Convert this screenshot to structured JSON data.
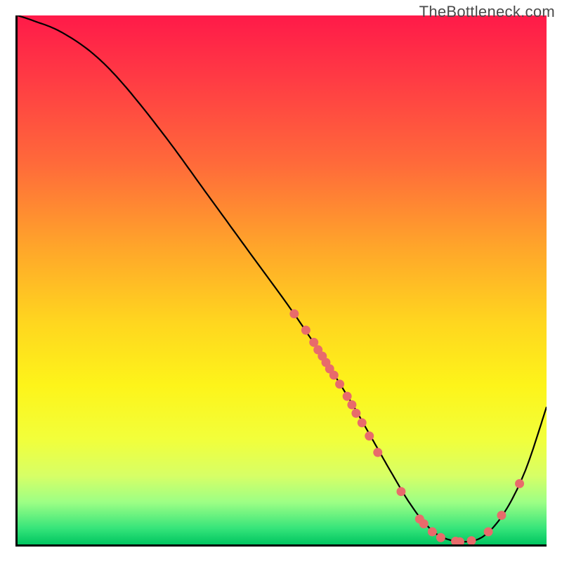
{
  "watermark_text": "TheBottleneck.com",
  "colors": {
    "gradient_stops": [
      "#ff1a49",
      "#ff3b44",
      "#ff6a3a",
      "#ffa62a",
      "#ffd61f",
      "#fdf41a",
      "#f2ff3a",
      "#d7ff66",
      "#9dff85",
      "#35e47a",
      "#00c560"
    ],
    "curve": "#000000",
    "dot": "#e86b6b",
    "axis": "#000000"
  },
  "chart_data": {
    "type": "line",
    "title": "",
    "xlabel": "",
    "ylabel": "",
    "xlim": [
      0,
      100
    ],
    "ylim": [
      0,
      100
    ],
    "grid": false,
    "legend": false,
    "gradient_axis": "y (bottleneck severity, red=high, green=low)",
    "series": [
      {
        "name": "bottleneck-curve",
        "x": [
          0,
          3,
          8,
          14,
          20,
          28,
          36,
          44,
          52,
          58,
          63,
          67,
          71,
          74,
          77,
          80,
          84,
          88,
          92,
          96,
          100
        ],
        "y": [
          100,
          99,
          97,
          93,
          87,
          77,
          66,
          55,
          44,
          35,
          27,
          20,
          13,
          8,
          4,
          1.5,
          0.5,
          1.5,
          6,
          14,
          26
        ]
      }
    ],
    "markers": [
      {
        "name": "data-point",
        "x": 52.3,
        "y": 43.6
      },
      {
        "name": "data-point",
        "x": 54.5,
        "y": 40.5
      },
      {
        "name": "data-point",
        "x": 56.0,
        "y": 38.2
      },
      {
        "name": "data-point",
        "x": 56.8,
        "y": 36.8
      },
      {
        "name": "data-point",
        "x": 57.6,
        "y": 35.6
      },
      {
        "name": "data-point",
        "x": 58.3,
        "y": 34.4
      },
      {
        "name": "data-point",
        "x": 59.0,
        "y": 33.2
      },
      {
        "name": "data-point",
        "x": 59.8,
        "y": 32.0
      },
      {
        "name": "data-point",
        "x": 60.9,
        "y": 30.3
      },
      {
        "name": "data-point",
        "x": 62.3,
        "y": 28.0
      },
      {
        "name": "data-point",
        "x": 63.2,
        "y": 26.4
      },
      {
        "name": "data-point",
        "x": 64.0,
        "y": 24.8
      },
      {
        "name": "data-point",
        "x": 65.1,
        "y": 23.0
      },
      {
        "name": "data-point",
        "x": 66.5,
        "y": 20.5
      },
      {
        "name": "data-point",
        "x": 68.1,
        "y": 17.4
      },
      {
        "name": "data-point",
        "x": 72.5,
        "y": 10.0
      },
      {
        "name": "data-point",
        "x": 76.0,
        "y": 4.8
      },
      {
        "name": "data-point",
        "x": 76.8,
        "y": 3.9
      },
      {
        "name": "data-point",
        "x": 78.4,
        "y": 2.4
      },
      {
        "name": "data-point",
        "x": 80.0,
        "y": 1.3
      },
      {
        "name": "data-point",
        "x": 82.8,
        "y": 0.6
      },
      {
        "name": "data-point",
        "x": 83.6,
        "y": 0.5
      },
      {
        "name": "data-point",
        "x": 85.8,
        "y": 0.7
      },
      {
        "name": "data-point",
        "x": 89.0,
        "y": 2.4
      },
      {
        "name": "data-point",
        "x": 91.5,
        "y": 5.5
      },
      {
        "name": "data-point",
        "x": 94.9,
        "y": 11.5
      }
    ]
  }
}
